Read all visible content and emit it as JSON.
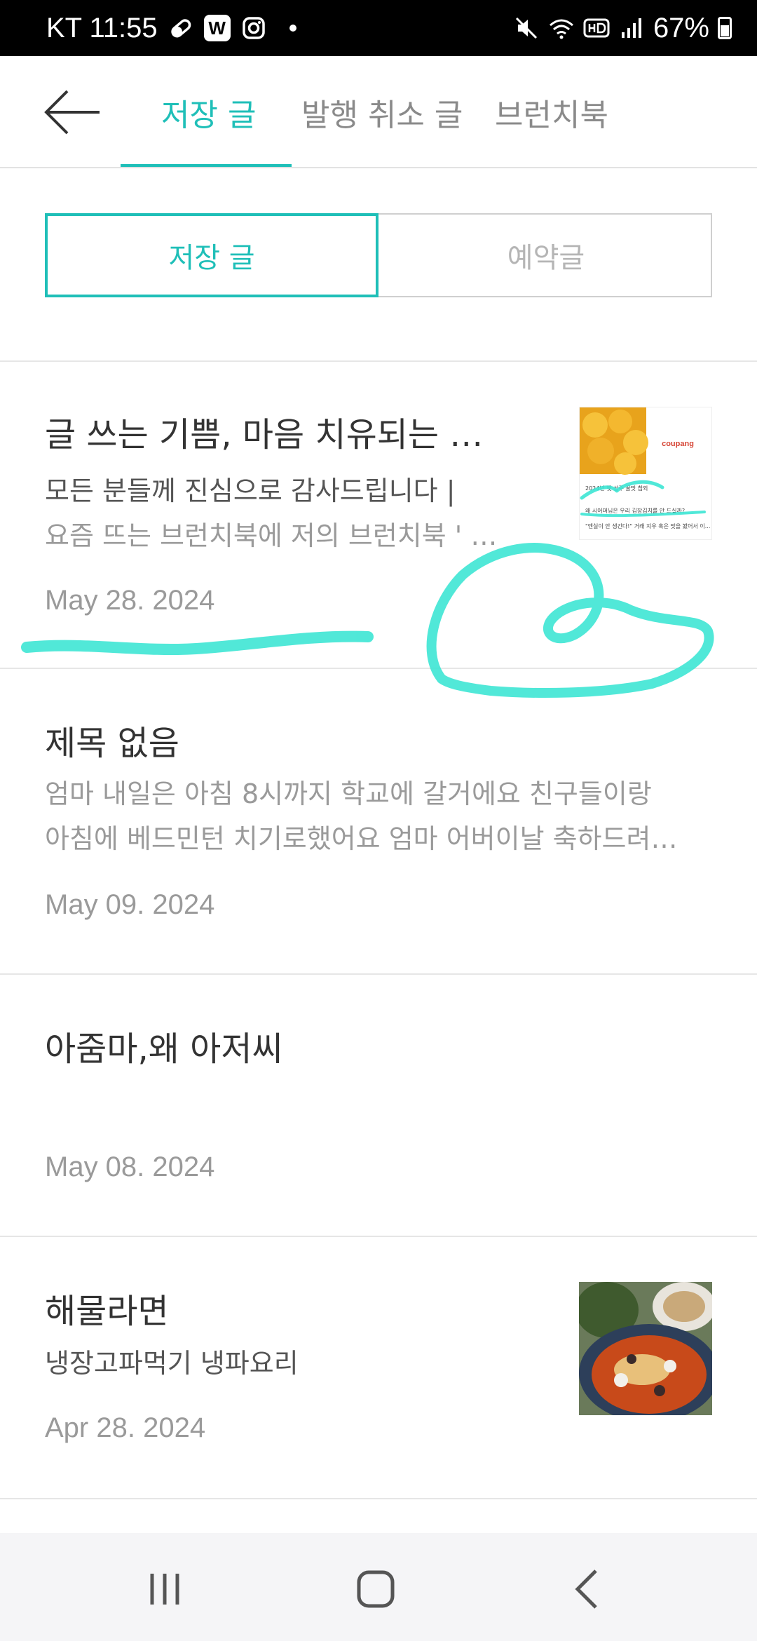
{
  "status_bar": {
    "carrier_time": "KT 11:55",
    "w_badge": "W",
    "battery": "67%",
    "icons": [
      "pill-icon",
      "w-app-icon",
      "instagram-icon",
      "mute-icon",
      "wifi-icon",
      "hd-icon",
      "signal-icon",
      "battery-icon"
    ]
  },
  "header": {
    "tabs": [
      {
        "label": "저장 글",
        "active": true
      },
      {
        "label": "발행 취소 글",
        "active": false
      },
      {
        "label": "브런치북",
        "active": false
      }
    ]
  },
  "segment": {
    "options": [
      {
        "label": "저장 글",
        "active": true
      },
      {
        "label": "예약글",
        "active": false
      }
    ]
  },
  "posts": [
    {
      "title": "글 쓰는 기쁨, 마음 치유되는 …",
      "excerpt_lines": [
        "모든 분들께 진심으로 감사드립니다  |",
        " 요즘 뜨는 브런치북에 저의 브런치북 ' …"
      ],
      "date": "May 28. 2024",
      "thumbnail": "coupang-ad-screenshot",
      "thumb_text": {
        "brand": "coupang",
        "line1": "2024년 햇 성주 꿀맛 참외",
        "line2": "왜 시어머님은 우리 김장김치를 안 드실까?",
        "line3": "\"엔실이 안 생긴다!\" 거래 지우 혹은 맛을 봤어서 이..."
      }
    },
    {
      "title": "제목 없음",
      "excerpt_lines": [
        "엄마 내일은 아침 8시까지 학교에 갈거에요 친구들이랑",
        "아침에 베드민턴 치기로했어요  엄마 어버이날 축하드려…"
      ],
      "date": "May 09. 2024",
      "thumbnail": null
    },
    {
      "title": "아줌마,왜 아저씨",
      "excerpt_lines": [],
      "date": "May 08. 2024",
      "thumbnail": null
    },
    {
      "title": "해물라면",
      "excerpt_lines": [
        "냉장고파먹기 냉파요리"
      ],
      "date": "Apr 28. 2024",
      "thumbnail": "seafood-ramen-photo"
    }
  ],
  "colors": {
    "accent": "#1fbfb8",
    "scribble": "#3ee6d4",
    "status_bar_bg": "#000000",
    "nav_bg": "#f5f5f7"
  }
}
